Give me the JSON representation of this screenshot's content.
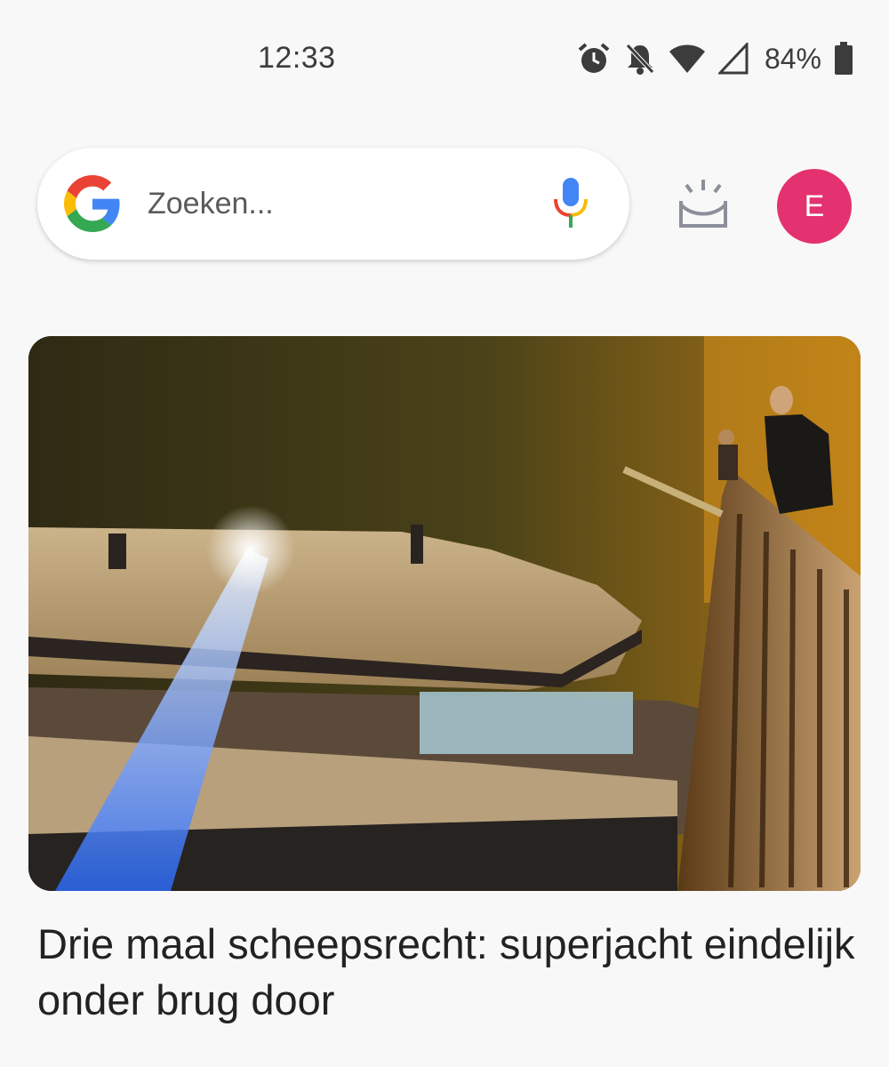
{
  "status_bar": {
    "time": "12:33",
    "battery_percent": "84%",
    "icons": [
      "alarm-icon",
      "notifications-off-icon",
      "wifi-icon",
      "cell-signal-icon",
      "battery-icon"
    ]
  },
  "search": {
    "placeholder": "Zoeken...",
    "logo": "google-g-logo",
    "mic_icon": "microphone-icon"
  },
  "header_actions": {
    "snapshot_icon": "snapshot-icon",
    "avatar_letter": "E",
    "avatar_color": "#e3326f"
  },
  "feed": {
    "cards": [
      {
        "image": "yacht-under-bridge-photo",
        "headline": "Drie maal scheepsrecht: superjacht eindelijk onder brug door"
      }
    ]
  }
}
